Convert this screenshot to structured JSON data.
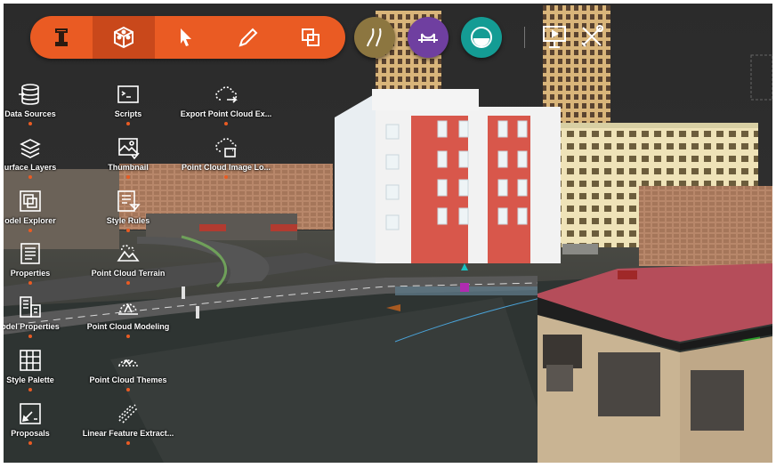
{
  "toolbar": {
    "buttons": [
      {
        "icon": "infraworks-logo-icon",
        "active": false
      },
      {
        "icon": "model-cube-icon",
        "active": true
      },
      {
        "icon": "select-arrow-icon",
        "active": false
      },
      {
        "icon": "pencil-icon",
        "active": false
      },
      {
        "icon": "overlap-squares-icon",
        "active": false
      }
    ],
    "accent": "#ea5b23"
  },
  "mode_buttons": [
    {
      "icon": "road-icon",
      "color": "#8c7640"
    },
    {
      "icon": "bridge-icon",
      "color": "#6f3fa0"
    },
    {
      "icon": "drainage-icon",
      "color": "#149c94"
    }
  ],
  "right_icons": [
    "presentation-icon",
    "crossed-tools-icon"
  ],
  "tools": [
    {
      "label": "Data Sources",
      "icon": "database-icon"
    },
    {
      "label": "Scripts",
      "icon": "terminal-icon"
    },
    {
      "label": "Export Point Cloud Ex...",
      "icon": "export-cloud-icon"
    },
    {
      "label": "urface Layers",
      "icon": "layers-icon"
    },
    {
      "label": "Thumbnail",
      "icon": "thumbnail-icon"
    },
    {
      "label": "Point Cloud Image Lo...",
      "icon": "cloud-image-icon"
    },
    {
      "label": "odel Explorer",
      "icon": "model-explorer-icon"
    },
    {
      "label": "Style Rules",
      "icon": "style-rules-icon"
    },
    {
      "label": "Properties",
      "icon": "properties-icon"
    },
    {
      "label": "Point Cloud Terrain",
      "icon": "cloud-terrain-icon"
    },
    {
      "label": "odel Properties",
      "icon": "model-properties-icon"
    },
    {
      "label": "Point Cloud Modeling",
      "icon": "cloud-modeling-icon"
    },
    {
      "label": "Style Palette",
      "icon": "style-palette-icon"
    },
    {
      "label": "Point Cloud Themes",
      "icon": "cloud-themes-icon"
    },
    {
      "label": "Proposals",
      "icon": "proposals-icon"
    },
    {
      "label": "Linear Feature Extract...",
      "icon": "linear-feature-icon"
    }
  ]
}
